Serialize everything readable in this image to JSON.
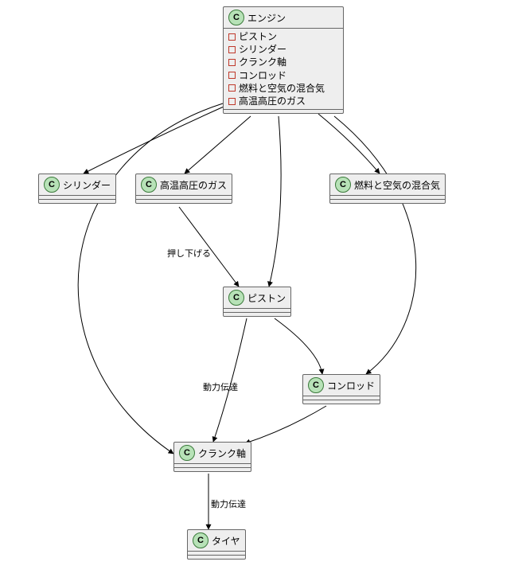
{
  "badge_letter": "C",
  "nodes": {
    "engine": {
      "title": "エンジン",
      "attrs": [
        "ピストン",
        "シリンダー",
        "クランク軸",
        "コンロッド",
        "燃料と空気の混合気",
        "高温高圧のガス"
      ]
    },
    "cylinder": {
      "title": "シリンダー"
    },
    "hotgas": {
      "title": "高温高圧のガス"
    },
    "mixture": {
      "title": "燃料と空気の混合気"
    },
    "piston": {
      "title": "ピストン"
    },
    "conrod": {
      "title": "コンロッド"
    },
    "crank": {
      "title": "クランク軸"
    },
    "tire": {
      "title": "タイヤ"
    }
  },
  "edge_labels": {
    "push_down": "押し下げる",
    "power_transmit_1": "動力伝達",
    "power_transmit_2": "動力伝達"
  }
}
